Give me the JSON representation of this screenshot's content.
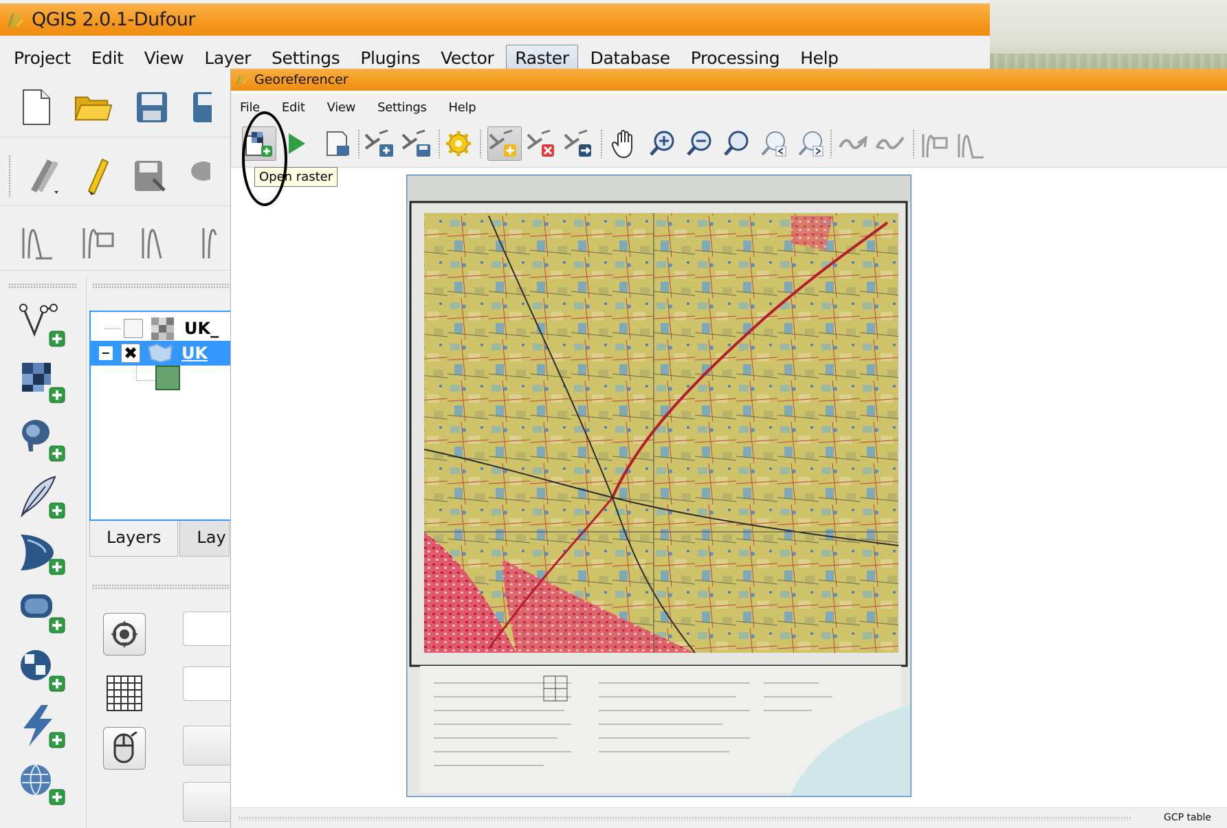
{
  "qgis": {
    "title": "QGIS 2.0.1-Dufour",
    "menu": [
      "Project",
      "Edit",
      "View",
      "Layer",
      "Settings",
      "Plugins",
      "Vector",
      "Raster",
      "Database",
      "Processing",
      "Help"
    ],
    "active_menu": "Raster",
    "layers": [
      {
        "name": "UK_",
        "checked": false,
        "selected": false
      },
      {
        "name": "UK",
        "checked": true,
        "selected": true
      }
    ],
    "tabs": [
      "Layers",
      "Lay"
    ]
  },
  "georeferencer": {
    "title": "Georeferencer",
    "menu": [
      "File",
      "Edit",
      "View",
      "Settings",
      "Help"
    ],
    "tooltip": "Open raster",
    "status_label": "GCP table",
    "toolbar_icons": [
      "open-raster-icon",
      "start-georeferencing-icon",
      "generate-gdal-script-icon",
      "load-gcp-points-icon",
      "save-gcp-points-icon",
      "transformation-settings-icon",
      "add-point-icon",
      "delete-point-icon",
      "move-gcp-point-icon",
      "pan-icon",
      "zoom-in-icon",
      "zoom-out-icon",
      "zoom-to-layer-icon",
      "zoom-last-icon",
      "zoom-next-icon",
      "link-georeferencer-to-qgis-icon",
      "link-qgis-to-georeferencer-icon",
      "histogram-stretch-icon",
      "local-histogram-stretch-icon"
    ]
  },
  "colors": {
    "titlebar": "#f59a1f",
    "selection": "#3399ff",
    "tooltip_bg": "#ffffe1"
  }
}
